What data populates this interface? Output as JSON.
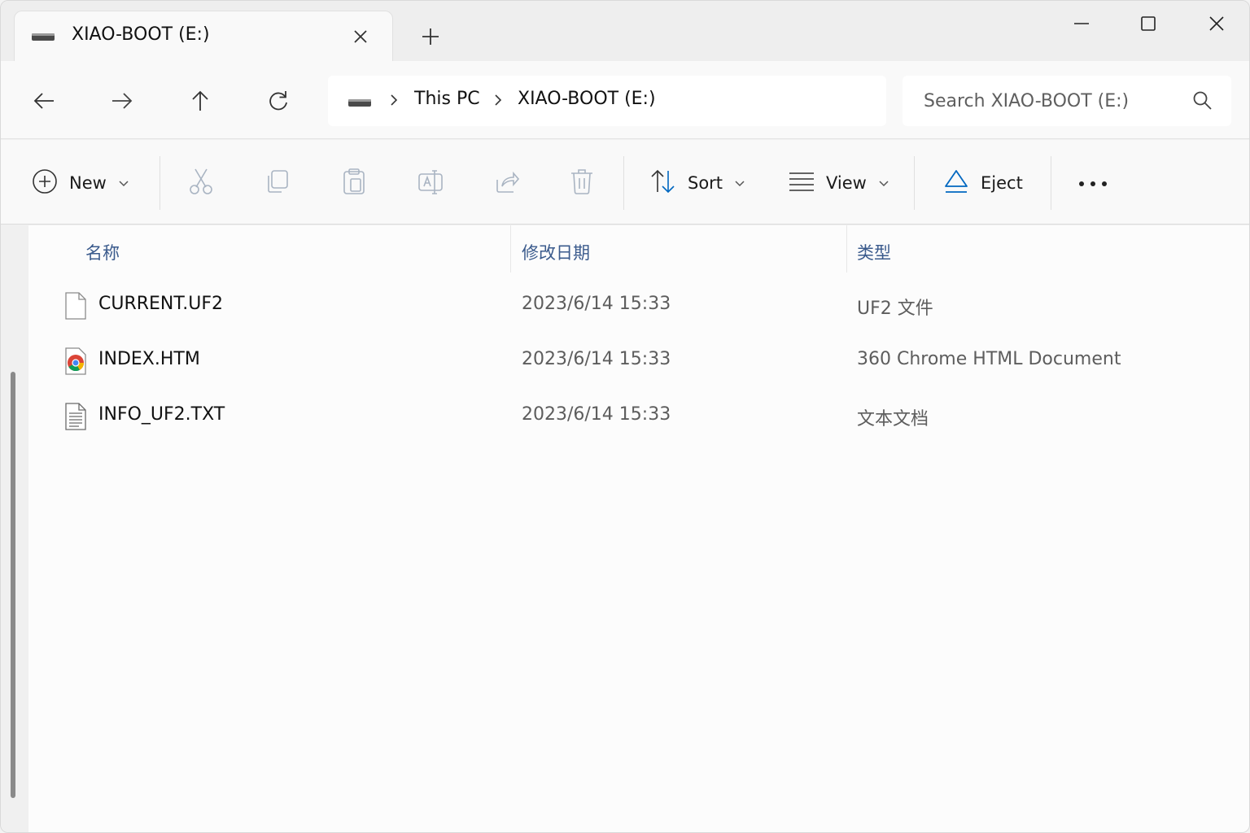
{
  "tab": {
    "title": "XIAO-BOOT (E:)"
  },
  "breadcrumb": [
    "This PC",
    "XIAO-BOOT (E:)"
  ],
  "search": {
    "placeholder": "Search XIAO-BOOT (E:)"
  },
  "commands": {
    "new_label": "New",
    "sort_label": "Sort",
    "view_label": "View",
    "eject_label": "Eject"
  },
  "columns": {
    "name": "名称",
    "date": "修改日期",
    "type": "类型"
  },
  "files": [
    {
      "name": "CURRENT.UF2",
      "date": "2023/6/14 15:33",
      "type": "UF2 文件",
      "icon": "blank-file-icon"
    },
    {
      "name": "INDEX.HTM",
      "date": "2023/6/14 15:33",
      "type": "360 Chrome HTML Document",
      "icon": "chrome-icon"
    },
    {
      "name": "INFO_UF2.TXT",
      "date": "2023/6/14 15:33",
      "type": "文本文档",
      "icon": "text-file-icon"
    }
  ],
  "colors": {
    "accent": "#0067c0",
    "header_text": "#3a5a8c",
    "disabled_icon": "#a9b4c2"
  }
}
